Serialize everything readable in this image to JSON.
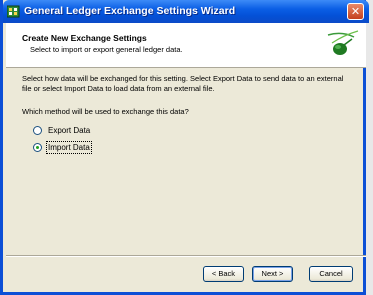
{
  "window": {
    "title": "General Ledger Exchange Settings Wizard",
    "close_glyph": "✕"
  },
  "header": {
    "title": "Create New Exchange Settings",
    "subtitle": "Select to import or export general ledger data."
  },
  "body": {
    "description": "Select how data will be exchanged for this setting. Select Export Data to send data to an external file or select Import Data to load data from an external file.",
    "question": "Which method will be used to exchange this data?",
    "options": [
      {
        "label": "Export Data",
        "selected": false
      },
      {
        "label": "Import Data",
        "selected": true
      }
    ]
  },
  "buttons": {
    "back": "< Back",
    "next": "Next >",
    "cancel": "Cancel"
  },
  "icons": {
    "title_icon": "ledger-app-icon",
    "header_logo": "wizard-leaf-logo"
  },
  "colors": {
    "titlebar": "#0a5ee5",
    "dialog_bg": "#ece9d8",
    "close_button": "#c4401d",
    "radio_dot": "#21a121"
  }
}
